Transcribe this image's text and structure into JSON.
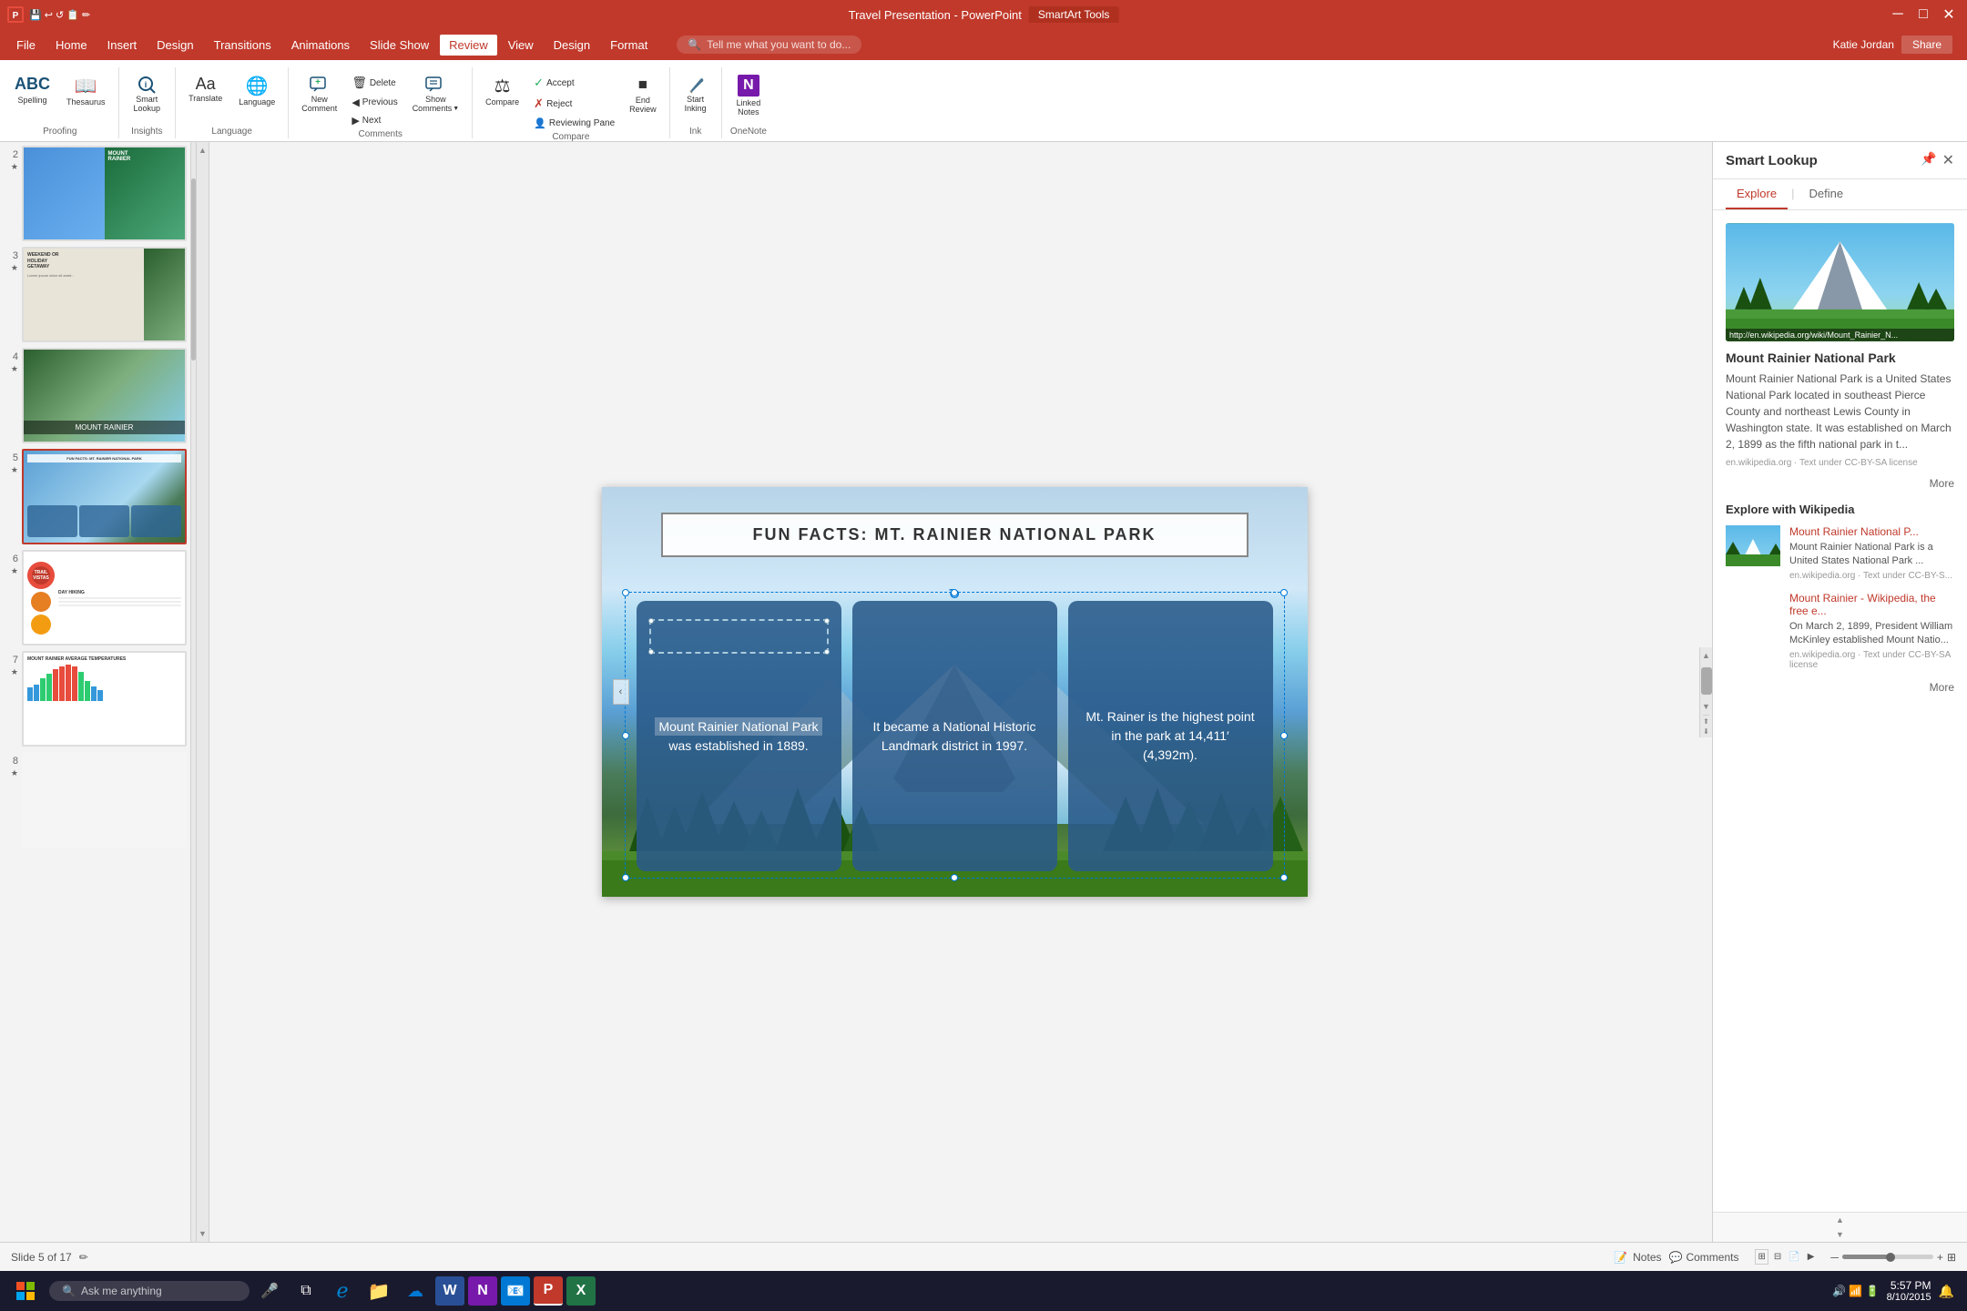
{
  "titlebar": {
    "title": "Travel Presentation - PowerPoint",
    "tools_label": "SmartArt Tools",
    "min_btn": "─",
    "max_btn": "□",
    "close_btn": "✕"
  },
  "menubar": {
    "items": [
      "File",
      "Home",
      "Insert",
      "Design",
      "Transitions",
      "Animations",
      "Slide Show",
      "Review",
      "View",
      "Design",
      "Format"
    ]
  },
  "ribbon": {
    "active_tab": "Review",
    "groups": [
      {
        "label": "Proofing",
        "buttons": [
          {
            "icon": "ABC",
            "label": "Spelling"
          },
          {
            "icon": "📖",
            "label": "Thesaurus"
          }
        ]
      },
      {
        "label": "Insights",
        "buttons": [
          {
            "icon": "🔍",
            "label": "Smart Lookup"
          }
        ]
      },
      {
        "label": "Language",
        "buttons": [
          {
            "icon": "Aa",
            "label": "Translate"
          },
          {
            "icon": "🌐",
            "label": "Language"
          }
        ]
      },
      {
        "label": "Comments",
        "buttons": [
          {
            "icon": "💬",
            "label": "New Comment"
          },
          {
            "icon": "🗑",
            "label": "Delete"
          },
          {
            "icon": "◀",
            "label": "Previous"
          },
          {
            "icon": "▶",
            "label": "Next"
          },
          {
            "icon": "💬",
            "label": "Show Comments"
          }
        ]
      },
      {
        "label": "Compare",
        "buttons": [
          {
            "icon": "⚖",
            "label": "Compare"
          },
          {
            "icon": "✓",
            "label": "Accept"
          },
          {
            "icon": "✗",
            "label": "Reject"
          },
          {
            "icon": "👤",
            "label": "Reviewing Pane"
          },
          {
            "icon": "⏹",
            "label": "End Review"
          }
        ]
      },
      {
        "label": "Ink",
        "buttons": [
          {
            "icon": "✏",
            "label": "Start Inking"
          }
        ]
      },
      {
        "label": "OneNote",
        "buttons": [
          {
            "icon": "N",
            "label": "Linked Notes"
          }
        ]
      }
    ]
  },
  "tell_me": {
    "placeholder": "Tell me what you want to do..."
  },
  "user": {
    "name": "Katie Jordan",
    "share_label": "Share"
  },
  "slides": [
    {
      "num": 2,
      "star": true,
      "type": "two-col"
    },
    {
      "num": 3,
      "star": true,
      "type": "text"
    },
    {
      "num": 4,
      "star": true,
      "type": "mountain"
    },
    {
      "num": 5,
      "star": true,
      "type": "facts",
      "active": true
    },
    {
      "num": 6,
      "star": true,
      "type": "circles"
    },
    {
      "num": 7,
      "star": true,
      "type": "table"
    },
    {
      "num": 8,
      "star": true,
      "type": "blank"
    }
  ],
  "slide": {
    "title": "FUN FACTS: MT. RAINIER NATIONAL PARK",
    "facts": [
      {
        "text_parts": [
          "Mount Rainier National Park",
          " was  established in 1889."
        ],
        "highlighted": "Mount Rainier National Park"
      },
      {
        "text": "It became a National Historic Landmark district in 1997."
      },
      {
        "text": "Mt. Rainer is the highest point in the park at 14,411′ (4,392m)."
      }
    ]
  },
  "smart_lookup": {
    "title": "Smart Lookup",
    "close_icon": "✕",
    "pin_icon": "📌",
    "tabs": [
      "Explore",
      "Define"
    ],
    "active_tab": "Explore",
    "image_caption": "http://en.wikipedia.org/wiki/Mount_Rainier_N...",
    "wiki_title": "Mount Rainier National Park",
    "wiki_text": "Mount Rainier National Park is a United States National Park located in southeast Pierce County and northeast Lewis County in Washington state. It was established on March 2, 1899 as the fifth national park in t...",
    "wiki_source": "en.wikipedia.org · Text under CC-BY-SA license",
    "more_label": "More",
    "explore_title": "Explore with Wikipedia",
    "results": [
      {
        "title": "Mount Rainier National P...",
        "snippet": "Mount Rainier National Park is a United States National Park ...",
        "source": "en.wikipedia.org · Text under CC-BY-S..."
      },
      {
        "title": "Mount Rainier - Wikipedia, the free e...",
        "snippet": "On March 2, 1899, President William McKinley established Mount Natio...",
        "source": "en.wikipedia.org · Text under CC-BY-SA license"
      }
    ],
    "more_label2": "More"
  },
  "status_bar": {
    "slide_info": "Slide 5 of 17",
    "notes_label": "Notes",
    "comments_label": "Comments",
    "zoom": "─────────────────",
    "zoom_pct": "",
    "time": "5:57 PM",
    "date": "8/10/2015"
  },
  "taskbar": {
    "search_placeholder": "Ask me anything",
    "apps": [
      "🪟",
      "🌐",
      "📁",
      "☁",
      "W",
      "N",
      "📧",
      "P",
      "X"
    ]
  }
}
